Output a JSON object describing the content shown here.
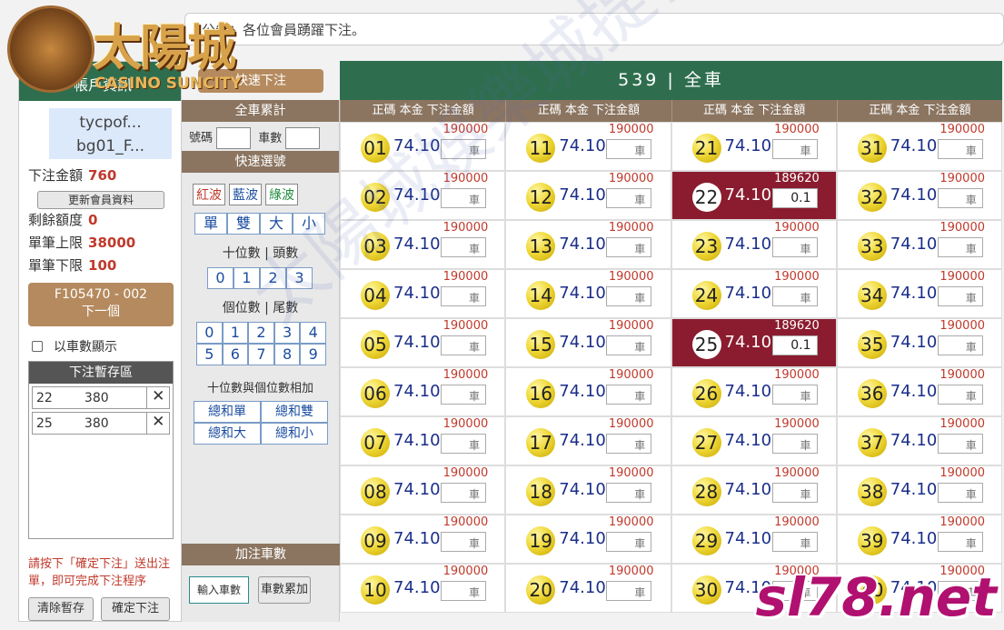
{
  "marquee": "公告：各位會員踴躍下注。",
  "logo": {
    "cn": "太陽城",
    "en": "CASINO SUNCITY"
  },
  "left": {
    "header": "帳戶資訊",
    "users": [
      "tycpof...",
      "bg01_F..."
    ],
    "bet_amount_label": "下注金額",
    "bet_amount": "760",
    "update_btn": "更新會員資料",
    "balance_label": "剩餘額度",
    "balance": "0",
    "max_label": "單筆上限",
    "max": "38000",
    "min_label": "單筆下限",
    "min": "100",
    "next_btn_code": "F105470 - 002",
    "next_btn": "下一個",
    "show_by_car": "以車數顯示",
    "store_title": "下注暫存區",
    "store": [
      {
        "num": "22",
        "amt": "380"
      },
      {
        "num": "25",
        "amt": "380"
      }
    ],
    "note": "請按下「確定下注」送出注單，即可完成下注程序",
    "clear_btn": "清除暫存",
    "confirm_btn": "確定下注"
  },
  "mid": {
    "fast_btn": "快速下注",
    "all_car": "全車累計",
    "num_label": "號碼",
    "car_label": "車數",
    "quick": "快速選號",
    "waves": [
      "紅波",
      "藍波",
      "綠波"
    ],
    "parity": [
      "單",
      "雙",
      "大",
      "小"
    ],
    "tens_title": "十位數 | 頭數",
    "tens": [
      "0",
      "1",
      "2",
      "3"
    ],
    "ones_title": "個位數 | 尾數",
    "ones": [
      "0",
      "1",
      "2",
      "3",
      "4",
      "5",
      "6",
      "7",
      "8",
      "9"
    ],
    "sum_title": "十位數與個位數相加",
    "sums": [
      "總和單",
      "總和雙",
      "總和大",
      "總和小"
    ],
    "add_title": "加注車數",
    "input_car": "輸入車數",
    "car_acc": "車數累加"
  },
  "grid": {
    "title": "539 | 全車",
    "col_header": "正碼 本金 下注金額",
    "odds": "74.10",
    "limit": "190000",
    "hot_limit": "189620",
    "car": "車",
    "hot_val": "0.1"
  },
  "watermark": "sl78.net",
  "bgmark": "太陽城娛樂城提供"
}
